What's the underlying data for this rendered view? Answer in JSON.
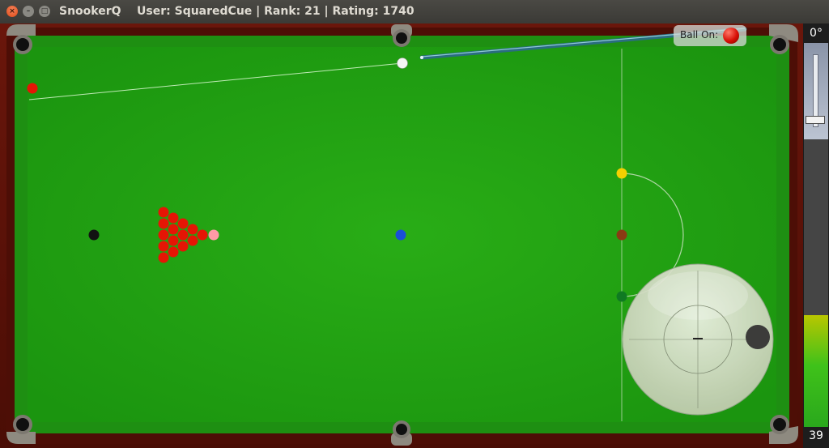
{
  "window": {
    "app_name": "SnookerQ",
    "info": "User: SquaredCue | Rank: 21 | Rating: 1740",
    "close_glyph": "×",
    "minimize_glyph": "–",
    "maximize_glyph": "□"
  },
  "hud": {
    "ball_on_label": "Ball On:",
    "ball_on_color": "#d80f06",
    "angle_label": "0°",
    "power_label": "39",
    "power_fraction": 0.39
  },
  "colors": {
    "cloth": "#22a012",
    "cushion": "#1f9212",
    "rail": "#5a1108",
    "red": "#e51505",
    "yellow": "#f4d000",
    "green": "#0f7a22",
    "brown": "#8a3a14",
    "blue": "#1a4fd8",
    "pink": "#ff9aa5",
    "black": "#121212",
    "cue": "#ffffff"
  },
  "icons": {
    "pocket": "pocket-icon",
    "spin_dot": "spin-dot-icon"
  }
}
